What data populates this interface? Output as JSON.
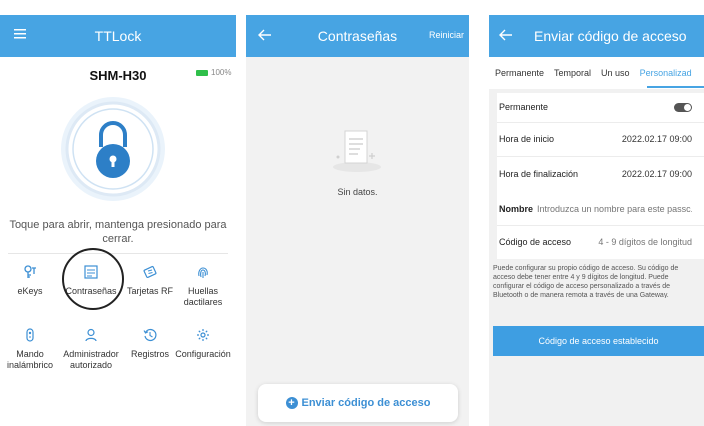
{
  "screen1": {
    "title": "TTLock",
    "device_name": "SHM-H30",
    "battery": "100%",
    "hint": "Toque para abrir, mantenga presionado para cerrar.",
    "grid": [
      {
        "label": "eKeys",
        "icon": "ekey-icon"
      },
      {
        "label": "Contraseñas",
        "icon": "passcode-icon"
      },
      {
        "label": "Tarjetas RF",
        "icon": "rf-card-icon"
      },
      {
        "label": "Huellas dactilares",
        "icon": "fingerprint-icon"
      },
      {
        "label": "Mando inalámbrico",
        "icon": "remote-icon"
      },
      {
        "label": "Administrador autorizado",
        "icon": "admin-icon"
      },
      {
        "label": "Registros",
        "icon": "records-icon"
      },
      {
        "label": "Configuración",
        "icon": "settings-icon"
      }
    ]
  },
  "screen2": {
    "title": "Contraseñas",
    "reset_label": "Reiniciar",
    "empty_text": "Sin datos.",
    "send_label": "Enviar código de acceso"
  },
  "screen3": {
    "title": "Enviar código de acceso",
    "tabs": [
      "Permanente",
      "Temporal",
      "Un uso",
      "Personalizad"
    ],
    "active_tab": "Personalizad",
    "permanent_label": "Permanente",
    "permanent_toggle_on": true,
    "start_label": "Hora de inicio",
    "start_value": "2022.02.17 09:00",
    "end_label": "Hora de finalización",
    "end_value": "2022.02.17 09:00",
    "name_label": "Nombre",
    "name_placeholder": "Introduzca un nombre para este passc...",
    "code_label": "Código de acceso",
    "code_placeholder": "4 - 9 dígitos de longitud",
    "info_text": "Puede configurar su propio código de acceso. Su código de acceso debe tener entre 4 y 9 dígitos de longitud. Puede configurar el código de acceso personalizado a través de Bluetooth o de manera remota a través de una Gateway.",
    "set_button": "Código de acceso establecido"
  },
  "colors": {
    "header": "#47a4e3",
    "accent": "#3c8fd4",
    "button": "#3e9ee2",
    "battery": "#2fbf4a"
  }
}
